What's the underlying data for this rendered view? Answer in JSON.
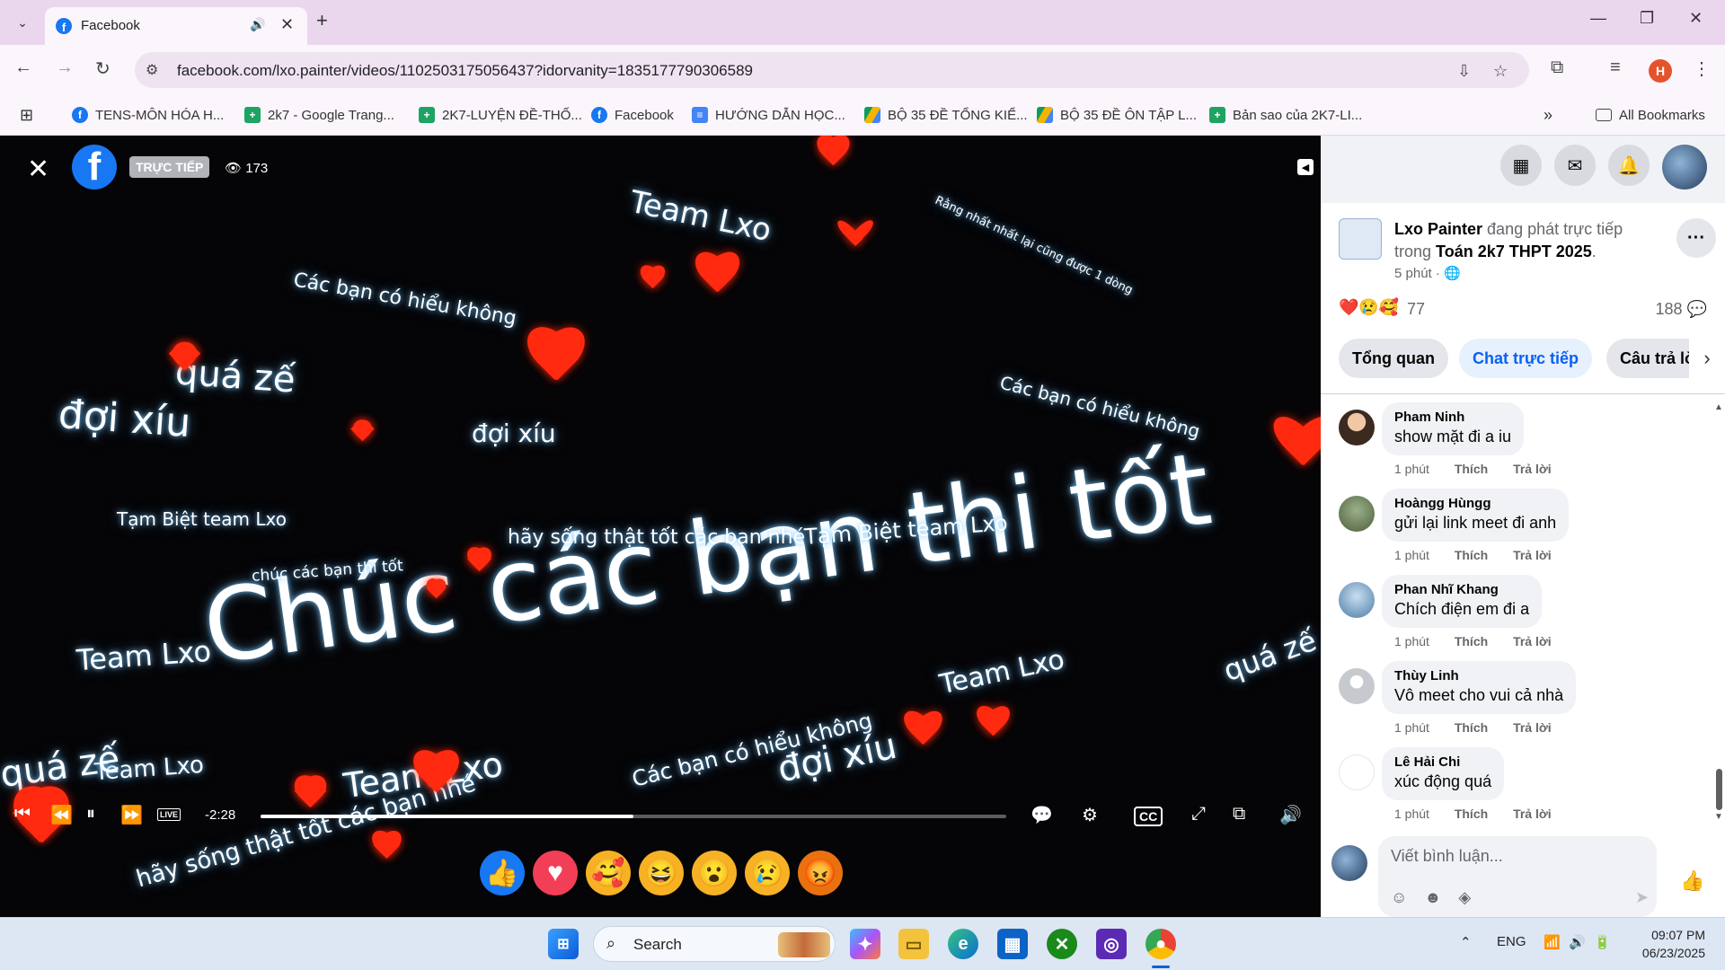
{
  "browser": {
    "tab_title": "Facebook",
    "url": "facebook.com/lxo.painter/videos/1102503175056437?idorvanity=1835177790306589",
    "profile_initial": "H",
    "bookmarks": [
      {
        "label": "TENS-MÔN HÓA H...",
        "icon": "facebook-icon",
        "color": "#1877f2"
      },
      {
        "label": "2k7 - Google Trang...",
        "icon": "sheets-icon",
        "color": "#1ea362"
      },
      {
        "label": "2K7-LUYỆN ĐỀ-THỐ...",
        "icon": "sheets-icon",
        "color": "#1ea362"
      },
      {
        "label": "Facebook",
        "icon": "facebook-icon",
        "color": "#1877f2"
      },
      {
        "label": "HƯỚNG DẪN HỌC...",
        "icon": "docs-icon",
        "color": "#4285f4"
      },
      {
        "label": "BỘ 35 ĐỀ TỔNG KIỂ...",
        "icon": "drive-icon",
        "color": "#f4b400"
      },
      {
        "label": "BỘ 35 ĐỀ ÔN TẬP L...",
        "icon": "drive-icon",
        "color": "#f4b400"
      },
      {
        "label": "Bản sao của 2K7-LI...",
        "icon": "sheets-icon",
        "color": "#1ea362"
      }
    ],
    "all_bookmarks": "All Bookmarks"
  },
  "video": {
    "live_badge": "TRỰC TIẾP",
    "viewers": "173",
    "time_remaining": "-2:28",
    "live_label": "LIVE",
    "progress": 0.5,
    "overlay_texts": [
      "Chúc các bạn thi tốt",
      "Team Lxo",
      "Các bạn có hiểu không",
      "quá zế",
      "đợi xíu",
      "Tạm Biệt team Lxo",
      "hãy sống thật tốt các bạn nhé",
      "chúc các bạn thi tốt",
      "Rằng nhất nhất lại cũng được 1 dòng"
    ],
    "reactions": [
      "like",
      "love",
      "care",
      "haha",
      "wow",
      "sad",
      "angry"
    ]
  },
  "panel": {
    "poster": "Lxo Painter",
    "post_action": "đang phát trực tiếp trong",
    "group": "Toán 2k7 THPT 2025",
    "post_time": "5 phút",
    "reaction_count": "77",
    "comment_count": "188",
    "tabs": [
      "Tổng quan",
      "Chat trực tiếp",
      "Câu trả lời"
    ],
    "comments": [
      {
        "name": "Pham Ninh",
        "text": "show mặt đi a iu",
        "time": "1 phút",
        "like": "Thích",
        "reply": "Trả lời"
      },
      {
        "name": "Hoàngg Hùngg",
        "text": "gửi lại link meet đi anh",
        "time": "1 phút",
        "like": "Thích",
        "reply": "Trả lời"
      },
      {
        "name": "Phan Nhĩ Khang",
        "text": "Chích điện em đi a",
        "time": "1 phút",
        "like": "Thích",
        "reply": "Trả lời"
      },
      {
        "name": "Thùy Linh",
        "text": "Vô meet cho vui cả nhà",
        "time": "1 phút",
        "like": "Thích",
        "reply": "Trả lời"
      },
      {
        "name": "Lê Hải Chi",
        "text": "xúc động quá",
        "time": "1 phút",
        "like": "Thích",
        "reply": "Trả lời"
      }
    ],
    "composer_placeholder": "Viết bình luận..."
  },
  "taskbar": {
    "search_label": "Search",
    "language": "ENG",
    "time": "09:07 PM",
    "date": "06/23/2025"
  }
}
